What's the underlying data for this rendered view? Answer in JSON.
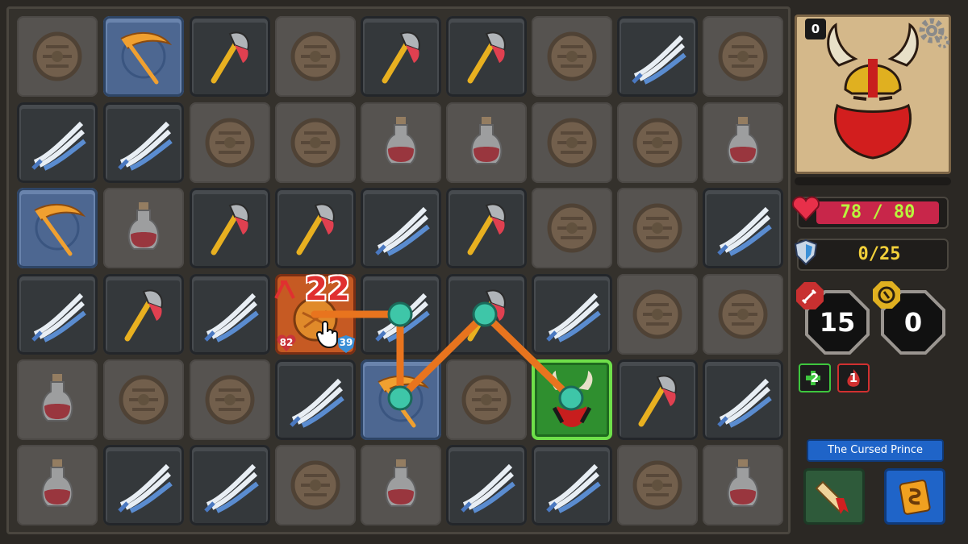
{
  "board": {
    "rows": [
      [
        {
          "icon": "shield-icon",
          "style": "dim"
        },
        {
          "icon": "scythe-icon",
          "style": "blue"
        },
        {
          "icon": "axe-icon",
          "style": "dark"
        },
        {
          "icon": "shield-icon",
          "style": "dim"
        },
        {
          "icon": "axe-icon",
          "style": "dark"
        },
        {
          "icon": "axe-icon",
          "style": "dark"
        },
        {
          "icon": "shield-icon",
          "style": "dim"
        },
        {
          "icon": "claw-icon",
          "style": "dark"
        },
        {
          "icon": "shield-icon",
          "style": "dim"
        }
      ],
      [
        {
          "icon": "claw-icon",
          "style": "dark"
        },
        {
          "icon": "claw-icon",
          "style": "dark"
        },
        {
          "icon": "shield-icon",
          "style": "dim"
        },
        {
          "icon": "shield-icon",
          "style": "dim"
        },
        {
          "icon": "potion-icon",
          "style": "dim"
        },
        {
          "icon": "potion-icon",
          "style": "dim"
        },
        {
          "icon": "shield-icon",
          "style": "dim"
        },
        {
          "icon": "shield-icon",
          "style": "dim"
        },
        {
          "icon": "potion-icon",
          "style": "dim"
        }
      ],
      [
        {
          "icon": "scythe-icon",
          "style": "blue"
        },
        {
          "icon": "potion-icon",
          "style": "dim"
        },
        {
          "icon": "axe-icon",
          "style": "dark"
        },
        {
          "icon": "axe-icon",
          "style": "dark"
        },
        {
          "icon": "claw-icon",
          "style": "dark"
        },
        {
          "icon": "axe-icon",
          "style": "dark"
        },
        {
          "icon": "shield-icon",
          "style": "dim"
        },
        {
          "icon": "shield-icon",
          "style": "dim"
        },
        {
          "icon": "claw-icon",
          "style": "dark"
        }
      ],
      [
        {
          "icon": "claw-icon",
          "style": "dark"
        },
        {
          "icon": "axe-icon",
          "style": "dark"
        },
        {
          "icon": "claw-icon",
          "style": "dark"
        },
        {
          "icon": "enemy-icon",
          "style": "enemy"
        },
        {
          "icon": "claw-icon",
          "style": "dark"
        },
        {
          "icon": "axe-icon",
          "style": "dark"
        },
        {
          "icon": "claw-icon",
          "style": "dark"
        },
        {
          "icon": "shield-icon",
          "style": "dim"
        },
        {
          "icon": "shield-icon",
          "style": "dim"
        }
      ],
      [
        {
          "icon": "potion-icon",
          "style": "dim"
        },
        {
          "icon": "shield-icon",
          "style": "dim"
        },
        {
          "icon": "shield-icon",
          "style": "dim"
        },
        {
          "icon": "claw-icon",
          "style": "dark"
        },
        {
          "icon": "scythe-icon",
          "style": "blue"
        },
        {
          "icon": "shield-icon",
          "style": "dim"
        },
        {
          "icon": "viking-icon",
          "style": "target"
        },
        {
          "icon": "axe-icon",
          "style": "dark"
        },
        {
          "icon": "claw-icon",
          "style": "dark"
        }
      ],
      [
        {
          "icon": "potion-icon",
          "style": "dim"
        },
        {
          "icon": "claw-icon",
          "style": "dark"
        },
        {
          "icon": "claw-icon",
          "style": "dark"
        },
        {
          "icon": "shield-icon",
          "style": "dim"
        },
        {
          "icon": "potion-icon",
          "style": "dim"
        },
        {
          "icon": "claw-icon",
          "style": "dark"
        },
        {
          "icon": "claw-icon",
          "style": "dark"
        },
        {
          "icon": "shield-icon",
          "style": "dim"
        },
        {
          "icon": "potion-icon",
          "style": "dim"
        }
      ]
    ]
  },
  "enemy": {
    "attack": "22",
    "hp": "82",
    "armor": "39"
  },
  "hero": {
    "portrait_count": "0",
    "health": "78 / 80",
    "health_fraction": 0.975,
    "armor": "0/25",
    "attack": "15",
    "gold": "0",
    "buff_green": "2",
    "buff_red": "1"
  },
  "level_name": "The Cursed Prince",
  "colors": {
    "path": "#e8741e",
    "node": "#3ec6a8",
    "hp": "#c8264a",
    "armor_text": "#f2d03a"
  }
}
